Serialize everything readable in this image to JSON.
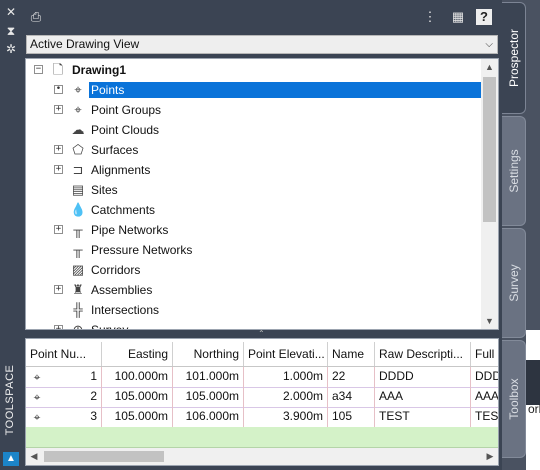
{
  "palette": {
    "side_title": "TOOLSPACE",
    "tabs": [
      {
        "label": "Prospector",
        "active": true
      },
      {
        "label": "Settings",
        "active": false
      },
      {
        "label": "Survey",
        "active": false
      },
      {
        "label": "Toolbox",
        "active": false
      }
    ],
    "background_text": "ork"
  },
  "view_select": {
    "value": "Active Drawing View"
  },
  "tree": {
    "root": "Drawing1",
    "items": [
      {
        "label": "Points",
        "icon": "points-icon",
        "expandable": true,
        "selected": true
      },
      {
        "label": "Point Groups",
        "icon": "point-groups-icon",
        "expandable": true
      },
      {
        "label": "Point Clouds",
        "icon": "point-clouds-icon",
        "expandable": false
      },
      {
        "label": "Surfaces",
        "icon": "surfaces-icon",
        "expandable": true
      },
      {
        "label": "Alignments",
        "icon": "alignments-icon",
        "expandable": true
      },
      {
        "label": "Sites",
        "icon": "sites-icon",
        "expandable": false
      },
      {
        "label": "Catchments",
        "icon": "catchments-icon",
        "expandable": false
      },
      {
        "label": "Pipe Networks",
        "icon": "pipe-networks-icon",
        "expandable": true
      },
      {
        "label": "Pressure Networks",
        "icon": "pressure-networks-icon",
        "expandable": false
      },
      {
        "label": "Corridors",
        "icon": "corridors-icon",
        "expandable": false
      },
      {
        "label": "Assemblies",
        "icon": "assemblies-icon",
        "expandable": true
      },
      {
        "label": "Intersections",
        "icon": "intersections-icon",
        "expandable": false
      },
      {
        "label": "Survey",
        "icon": "survey-icon",
        "expandable": true
      }
    ]
  },
  "grid": {
    "columns": [
      "Point Nu...",
      "Easting",
      "Northing",
      "Point Elevati...",
      "Name",
      "Raw Descripti...",
      "Full"
    ],
    "rows": [
      {
        "number": "1",
        "easting": "100.000m",
        "northing": "101.000m",
        "elevation": "1.000m",
        "name": "22",
        "raw_desc": "DDDD",
        "full": "DDD"
      },
      {
        "number": "2",
        "easting": "105.000m",
        "northing": "105.000m",
        "elevation": "2.000m",
        "name": "a34",
        "raw_desc": "AAA",
        "full": "AAA"
      },
      {
        "number": "3",
        "easting": "105.000m",
        "northing": "106.000m",
        "elevation": "3.900m",
        "name": "105",
        "raw_desc": "TEST",
        "full": "TEST"
      }
    ]
  },
  "colors": {
    "selection": "#0a73d9",
    "panel_bg": "#3b4453",
    "new_row": "#d4f2c8"
  }
}
